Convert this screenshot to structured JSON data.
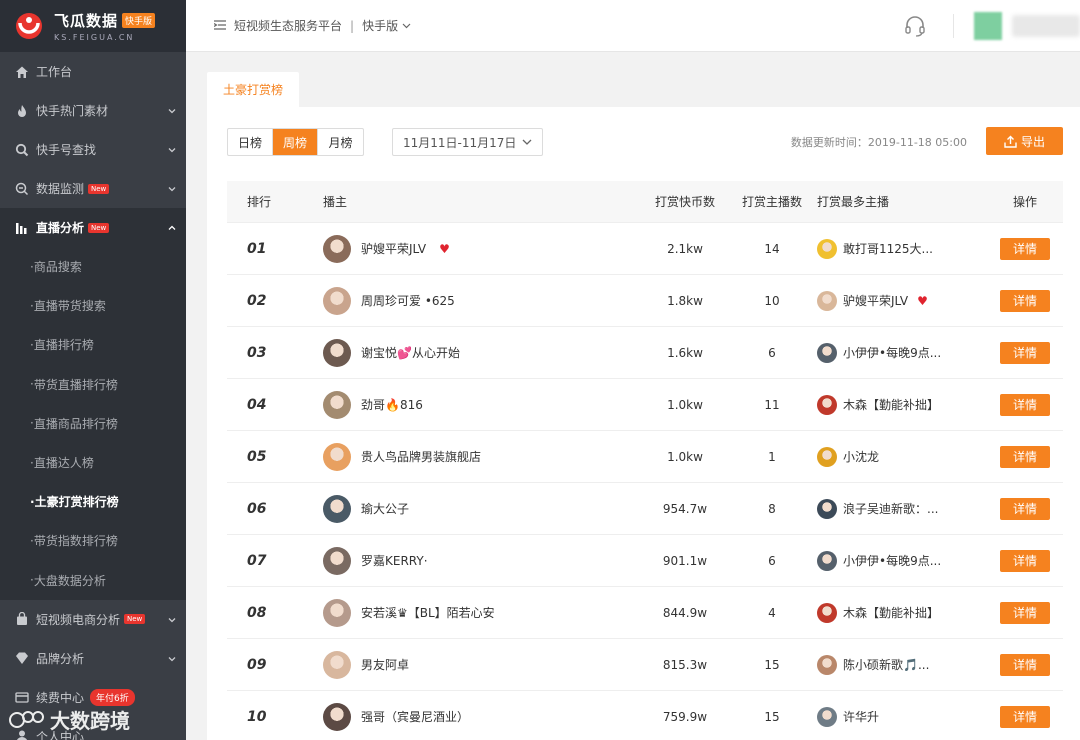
{
  "logo": {
    "title": "飞瓜数据",
    "badge": "快手版",
    "sub": "KS.FEIGUA.CN"
  },
  "sidebar": {
    "items": [
      {
        "label": "工作台",
        "icon": "home-icon"
      },
      {
        "label": "快手热门素材",
        "icon": "fire-icon"
      },
      {
        "label": "快手号查找",
        "icon": "search-icon"
      },
      {
        "label": "数据监测",
        "icon": "monitor-icon",
        "badge": "New"
      },
      {
        "label": "直播分析",
        "icon": "bar-chart-icon",
        "badge": "New"
      }
    ],
    "submenu": [
      "商品搜索",
      "直播带货搜索",
      "直播排行榜",
      "带货直播排行榜",
      "直播商品排行榜",
      "直播达人榜",
      "土豪打赏排行榜",
      "带货指数排行榜",
      "大盘数据分析"
    ],
    "lower": [
      {
        "label": "短视频电商分析",
        "icon": "bag-icon",
        "badge": "New"
      },
      {
        "label": "品牌分析",
        "icon": "diamond-icon"
      },
      {
        "label": "续费中心",
        "icon": "card-icon",
        "sale": "年付6折"
      },
      {
        "label": "个人中心",
        "icon": "user-icon"
      }
    ],
    "watermark": "大数跨境"
  },
  "topbar": {
    "platform": "短视频生态服务平台",
    "sep": "|",
    "version": "快手版"
  },
  "tab": {
    "label": "土豪打赏榜"
  },
  "toolbar": {
    "periods": [
      "日榜",
      "周榜",
      "月榜"
    ],
    "date_range": "11月11日-11月17日",
    "update_time": "数据更新时间：2019-11-18 05:00",
    "export_label": "导出"
  },
  "table": {
    "headers": {
      "rank": "排行",
      "anchor": "播主",
      "coins": "打赏快币数",
      "count": "打赏主播数",
      "top": "打赏最多主播",
      "op": "操作"
    },
    "detail_label": "详情",
    "rows": [
      {
        "rank": "01",
        "name": "驴嫂平荣JLV",
        "heart": "♥",
        "coins": "2.1kw",
        "count": "14",
        "top": "敢打哥1125大...",
        "top_heart": ""
      },
      {
        "rank": "02",
        "name": "周周珍可爱 •625",
        "heart": "",
        "coins": "1.8kw",
        "count": "10",
        "top": "驴嫂平荣JLV",
        "top_heart": "♥"
      },
      {
        "rank": "03",
        "name": "谢宝悦💕从心开始",
        "heart": "",
        "coins": "1.6kw",
        "count": "6",
        "top": "小伊伊•每晚9点...",
        "top_heart": ""
      },
      {
        "rank": "04",
        "name": "劲哥🔥816",
        "heart": "",
        "coins": "1.0kw",
        "count": "11",
        "top": "木森【勤能补拙】",
        "top_heart": ""
      },
      {
        "rank": "05",
        "name": "贵人鸟品牌男装旗舰店",
        "heart": "",
        "coins": "1.0kw",
        "count": "1",
        "top": "小沈龙",
        "top_heart": ""
      },
      {
        "rank": "06",
        "name": "瑜大公子",
        "heart": "",
        "coins": "954.7w",
        "count": "8",
        "top": "浪子吴迪新歌：...",
        "top_heart": ""
      },
      {
        "rank": "07",
        "name": "罗嘉KERRY·",
        "heart": "",
        "coins": "901.1w",
        "count": "6",
        "top": "小伊伊•每晚9点...",
        "top_heart": ""
      },
      {
        "rank": "08",
        "name": "安若溪♛【BL】陌若心安",
        "heart": "",
        "coins": "844.9w",
        "count": "4",
        "top": "木森【勤能补拙】",
        "top_heart": ""
      },
      {
        "rank": "09",
        "name": "男友阿卓",
        "heart": "",
        "coins": "815.3w",
        "count": "15",
        "top": "陈小硕新歌🎵...",
        "top_heart": ""
      },
      {
        "rank": "10",
        "name": "强哥（宾曼尼酒业）",
        "heart": "",
        "coins": "759.9w",
        "count": "15",
        "top": "许华升",
        "top_heart": ""
      }
    ]
  },
  "colors": {
    "accent": "#f5821f",
    "sidebar": "#3a3e45",
    "badge": "#e8352e"
  }
}
